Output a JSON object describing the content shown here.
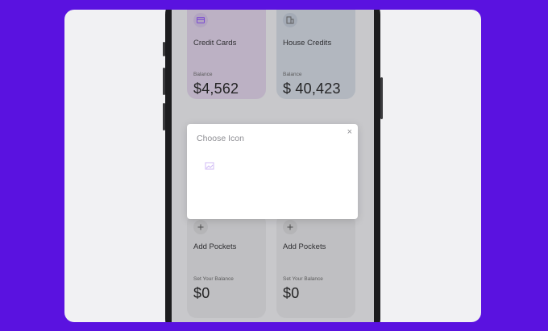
{
  "pockets": [
    {
      "title": "Credit Cards",
      "balance_label": "Balance",
      "amount": "$4,562",
      "icon": "card-icon",
      "color": "#cbbed3"
    },
    {
      "title": "House Credits",
      "balance_label": "Balance",
      "amount": "$ 40,423",
      "icon": "building-icon",
      "color": "#bfc5ce"
    },
    {
      "title": "Add Pockets",
      "balance_label": "Set Your Balance",
      "amount": "$0",
      "icon": "plus-icon",
      "color": "#cfcfd1"
    },
    {
      "title": "Add Pockets",
      "balance_label": "Set Your Balance",
      "amount": "$0",
      "icon": "plus-icon",
      "color": "#cfcfd1"
    }
  ],
  "modal": {
    "title": "Choose Icon",
    "close_symbol": "×",
    "placeholder_icon": "image-placeholder-icon"
  },
  "colors": {
    "background": "#5a12e0",
    "panel": "#f1f1f3",
    "accent": "#7b3fe4"
  }
}
